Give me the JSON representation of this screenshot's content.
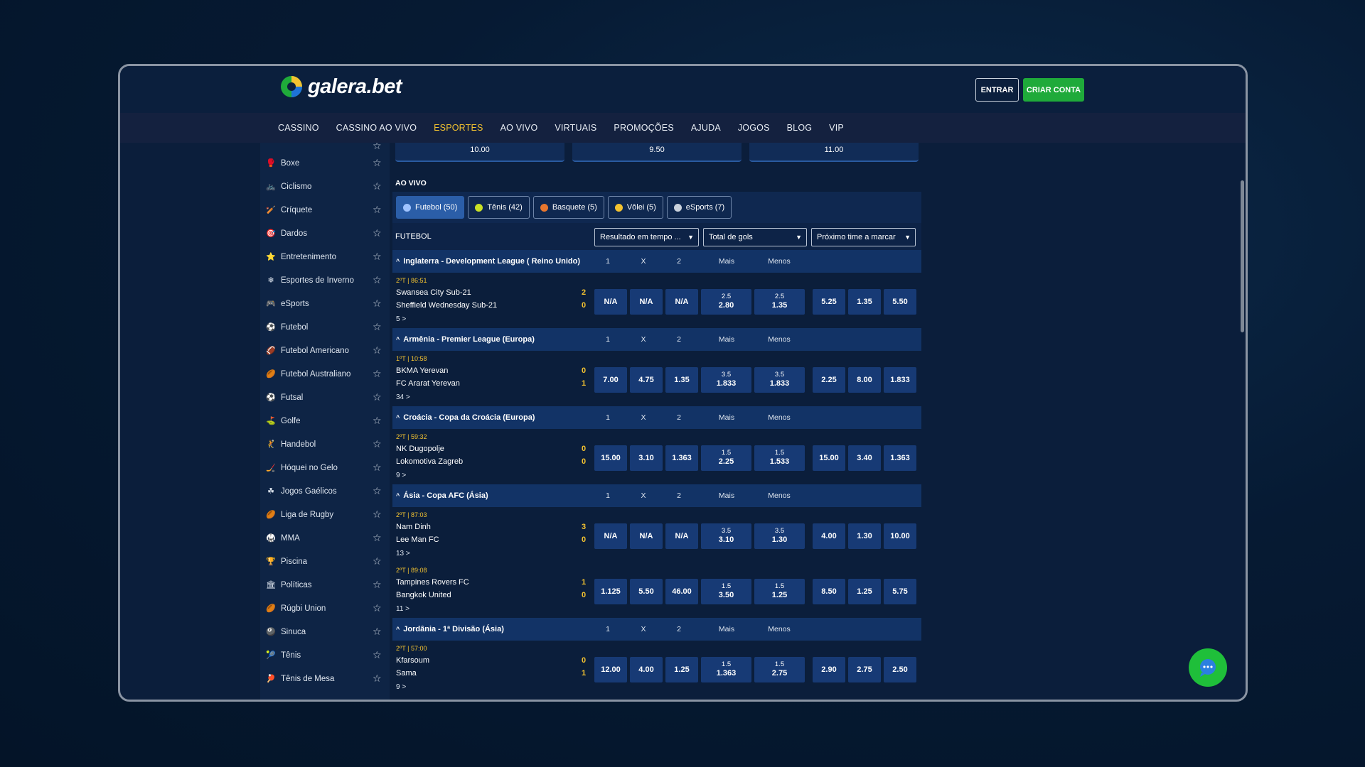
{
  "brand": {
    "name": "galera.bet"
  },
  "header": {
    "login_label": "ENTRAR",
    "signup_label": "CRIAR CONTA"
  },
  "nav": [
    {
      "label": "CASSINO"
    },
    {
      "label": "CASSINO AO VIVO"
    },
    {
      "label": "ESPORTES",
      "active": true
    },
    {
      "label": "AO VIVO"
    },
    {
      "label": "VIRTUAIS"
    },
    {
      "label": "PROMOÇÕES"
    },
    {
      "label": "AJUDA"
    },
    {
      "label": "JOGOS"
    },
    {
      "label": "BLOG"
    },
    {
      "label": "VIP"
    }
  ],
  "sidebar": {
    "items": [
      {
        "label": "Boxe",
        "icon": "boxing-glove-icon",
        "glyph": "🥊"
      },
      {
        "label": "Ciclismo",
        "icon": "bicycle-icon",
        "glyph": "🚲"
      },
      {
        "label": "Críquete",
        "icon": "cricket-bat-icon",
        "glyph": "🏏"
      },
      {
        "label": "Dardos",
        "icon": "darts-icon",
        "glyph": "🎯"
      },
      {
        "label": "Entretenimento",
        "icon": "entertainment-icon",
        "glyph": "⭐"
      },
      {
        "label": "Esportes de Inverno",
        "icon": "snowflake-icon",
        "glyph": "❄"
      },
      {
        "label": "eSports",
        "icon": "gamepad-icon",
        "glyph": "🎮"
      },
      {
        "label": "Futebol",
        "icon": "soccer-ball-icon",
        "glyph": "⚽"
      },
      {
        "label": "Futebol Americano",
        "icon": "american-football-icon",
        "glyph": "🏈"
      },
      {
        "label": "Futebol Australiano",
        "icon": "australian-football-icon",
        "glyph": "🏉"
      },
      {
        "label": "Futsal",
        "icon": "futsal-ball-icon",
        "glyph": "⚽"
      },
      {
        "label": "Golfe",
        "icon": "golf-icon",
        "glyph": "⛳"
      },
      {
        "label": "Handebol",
        "icon": "handball-icon",
        "glyph": "🤾"
      },
      {
        "label": "Hóquei no Gelo",
        "icon": "ice-hockey-icon",
        "glyph": "🏒"
      },
      {
        "label": "Jogos Gaélicos",
        "icon": "gaelic-games-icon",
        "glyph": "☘"
      },
      {
        "label": "Liga de Rugby",
        "icon": "rugby-league-icon",
        "glyph": "🏉"
      },
      {
        "label": "MMA",
        "icon": "mma-icon",
        "glyph": "🥋"
      },
      {
        "label": "Piscina",
        "icon": "trophy-icon",
        "glyph": "🏆"
      },
      {
        "label": "Políticas",
        "icon": "politics-icon",
        "glyph": "🏛"
      },
      {
        "label": "Rúgbi Union",
        "icon": "rugby-union-icon",
        "glyph": "🏉"
      },
      {
        "label": "Sinuca",
        "icon": "snooker-icon",
        "glyph": "🎱"
      },
      {
        "label": "Tênis",
        "icon": "tennis-ball-icon",
        "glyph": "🎾"
      },
      {
        "label": "Tênis de Mesa",
        "icon": "table-tennis-icon",
        "glyph": "🏓"
      }
    ]
  },
  "top_odds": [
    "10.00",
    "9.50",
    "11.00"
  ],
  "live": {
    "title": "AO VIVO",
    "tabs": [
      {
        "label": "Futebol (50)",
        "active": true,
        "color": "#9fc3ff"
      },
      {
        "label": "Tênis (42)",
        "color": "#c8e026"
      },
      {
        "label": "Basquete (5)",
        "color": "#e8772e"
      },
      {
        "label": "Vôlei (5)",
        "color": "#f2c230"
      },
      {
        "label": "eSports (7)",
        "color": "#c9d1dc"
      }
    ],
    "filter": {
      "label": "FUTEBOL",
      "selects": [
        "Resultado em tempo ...",
        "Total de gols",
        "Próximo time a marcar"
      ]
    },
    "columns": {
      "c1": "1",
      "cx": "X",
      "c2": "2",
      "over": "Mais",
      "under": "Menos"
    },
    "leagues": [
      {
        "name": "Inglaterra - Development League ( Reino Unido)",
        "matches": [
          {
            "time": "2ºT | 86:51",
            "home": "Swansea City Sub-21",
            "away": "Sheffield Wednesday Sub-21",
            "score_home": "2",
            "score_away": "0",
            "more": "5 >",
            "odds": [
              "N/A",
              "N/A",
              "N/A"
            ],
            "over_line": "2.5",
            "over": "2.80",
            "under_line": "2.5",
            "under": "1.35",
            "next": [
              "5.25",
              "1.35",
              "5.50"
            ]
          }
        ]
      },
      {
        "name": "Armênia - Premier League (Europa)",
        "matches": [
          {
            "time": "1ºT | 10:58",
            "home": "BKMA Yerevan",
            "away": "FC Ararat Yerevan",
            "score_home": "0",
            "score_away": "1",
            "more": "34 >",
            "odds": [
              "7.00",
              "4.75",
              "1.35"
            ],
            "over_line": "3.5",
            "over": "1.833",
            "under_line": "3.5",
            "under": "1.833",
            "next": [
              "2.25",
              "8.00",
              "1.833"
            ]
          }
        ]
      },
      {
        "name": "Croácia - Copa da Croácia (Europa)",
        "matches": [
          {
            "time": "2ºT | 59:32",
            "home": "NK Dugopolje",
            "away": "Lokomotiva Zagreb",
            "score_home": "0",
            "score_away": "0",
            "more": "9 >",
            "odds": [
              "15.00",
              "3.10",
              "1.363"
            ],
            "over_line": "1.5",
            "over": "2.25",
            "under_line": "1.5",
            "under": "1.533",
            "next": [
              "15.00",
              "3.40",
              "1.363"
            ]
          }
        ]
      },
      {
        "name": "Ásia - Copa AFC (Ásia)",
        "matches": [
          {
            "time": "2ºT | 87:03",
            "home": "Nam Dinh",
            "away": "Lee Man FC",
            "score_home": "3",
            "score_away": "0",
            "more": "13 >",
            "odds": [
              "N/A",
              "N/A",
              "N/A"
            ],
            "over_line": "3.5",
            "over": "3.10",
            "under_line": "3.5",
            "under": "1.30",
            "next": [
              "4.00",
              "1.30",
              "10.00"
            ]
          },
          {
            "time": "2ºT | 89:08",
            "home": "Tampines Rovers FC",
            "away": "Bangkok United",
            "score_home": "1",
            "score_away": "0",
            "more": "11 >",
            "odds": [
              "1.125",
              "5.50",
              "46.00"
            ],
            "over_line": "1.5",
            "over": "3.50",
            "under_line": "1.5",
            "under": "1.25",
            "next": [
              "8.50",
              "1.25",
              "5.75"
            ]
          }
        ]
      },
      {
        "name": "Jordânia - 1ª Divisão (Ásia)",
        "matches": [
          {
            "time": "2ºT | 57:00",
            "home": "Kfarsoum",
            "away": "Sama",
            "score_home": "0",
            "score_away": "1",
            "more": "9 >",
            "odds": [
              "12.00",
              "4.00",
              "1.25"
            ],
            "over_line": "1.5",
            "over": "1.363",
            "under_line": "1.5",
            "under": "2.75",
            "next": [
              "2.90",
              "2.75",
              "2.50"
            ]
          }
        ]
      }
    ]
  },
  "colors": {
    "accent": "#f2c230",
    "brand_green": "#1faa3a",
    "odd_bg": "#173a75",
    "league_bg": "#123366"
  }
}
